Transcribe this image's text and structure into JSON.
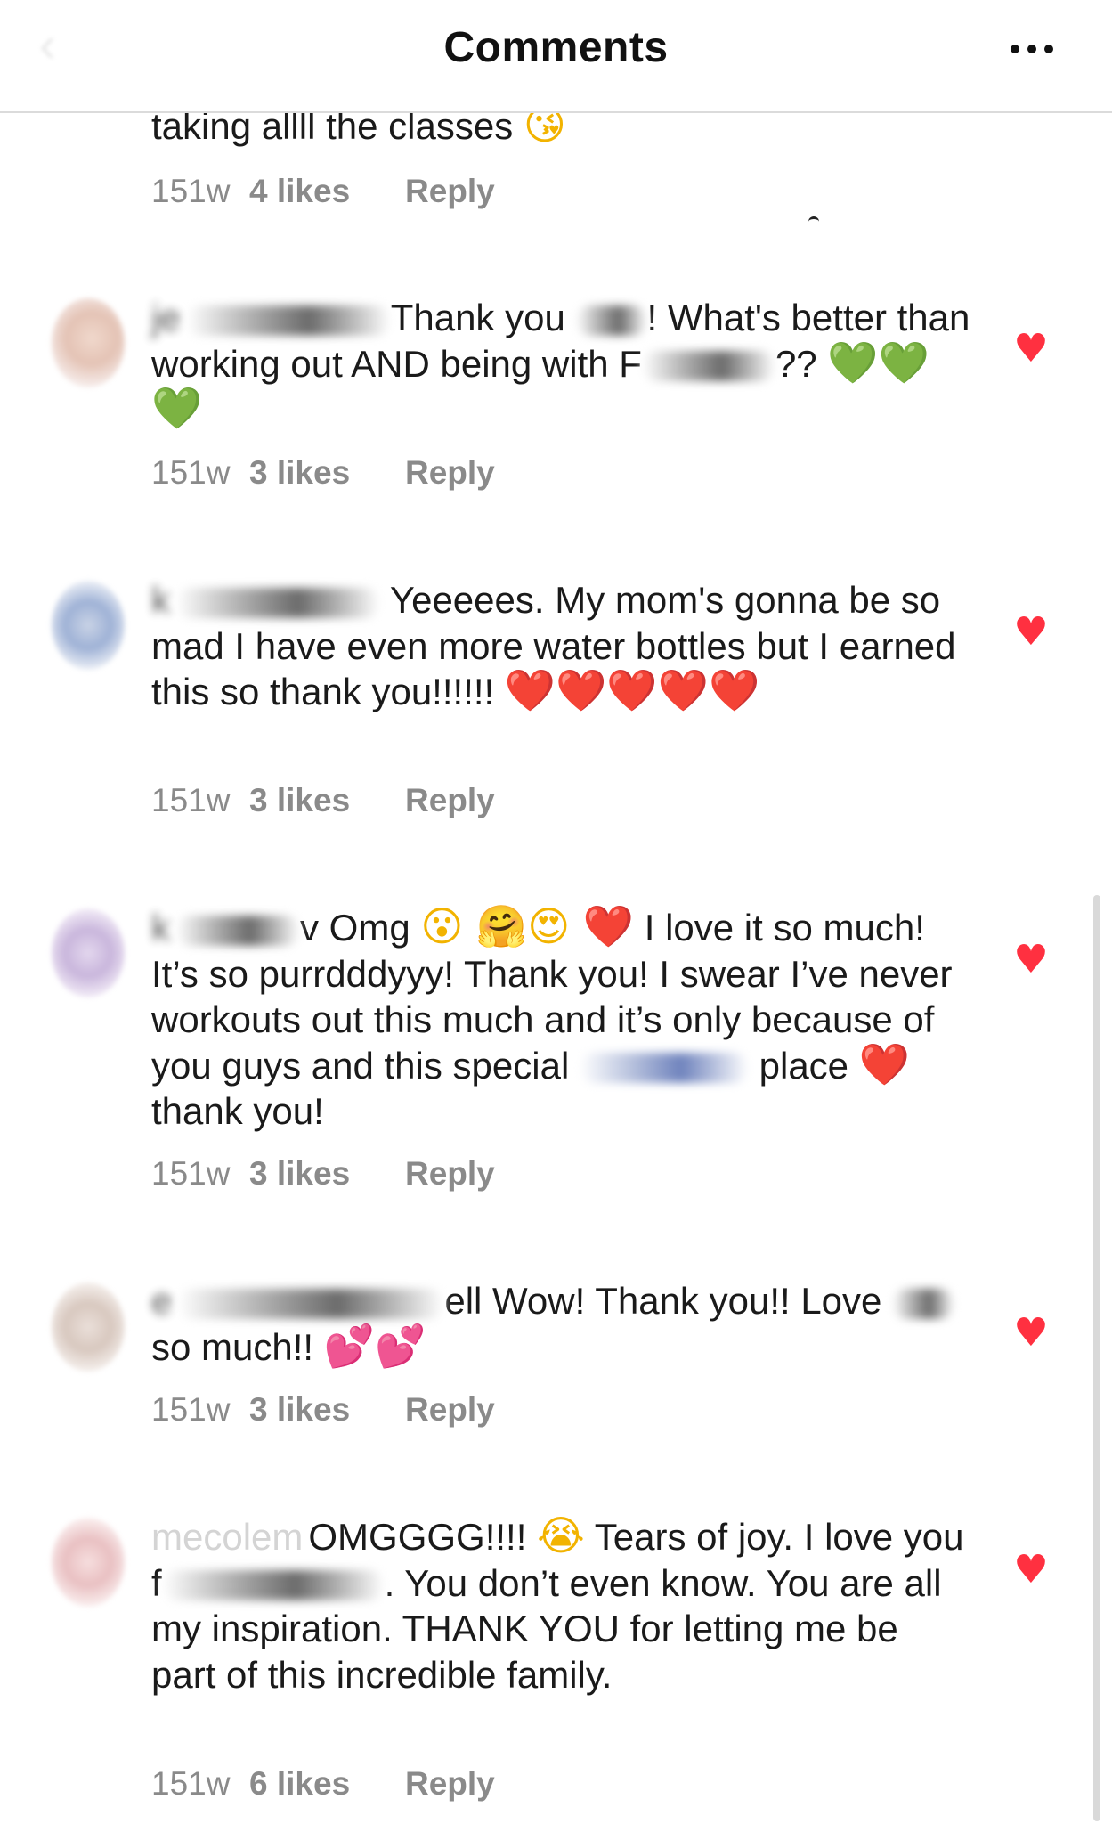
{
  "header": {
    "title": "Comments",
    "back_icon": "chevron-left-icon",
    "more_icon": "more-horizontal-icon"
  },
  "colors": {
    "heart": "#ff3040",
    "meta": "#8a8a8a",
    "divider": "#dbdbdb"
  },
  "first_comment": {
    "text": "taking allll the classes",
    "emoji": "😘",
    "time": "151w",
    "likes": "4 likes",
    "reply": "Reply"
  },
  "comments": [
    {
      "username": "je",
      "text_a": "Thank you",
      "text_b": "! What's better than working out AND being with",
      "text_c": "F",
      "text_d": "??",
      "emoji": "💚💚💚",
      "time": "151w",
      "likes": "3 likes",
      "reply": "Reply",
      "liked": true
    },
    {
      "username": "k",
      "text": "Yeeeees. My mom's gonna be so mad I have even more water bottles but I earned this so thank you!!!!!!",
      "emoji": "❤️❤️❤️❤️❤️",
      "time": "151w",
      "likes": "3 likes",
      "reply": "Reply",
      "liked": true
    },
    {
      "username": "k",
      "text_a": "v Omg",
      "emoji_a": "😮 🤗😍 ❤️",
      "text_b": "I love it so much! It’s so purrdddyyy! Thank you! I swear I’ve never workouts out this much and it’s only because of you guys and this special",
      "text_c": "place",
      "emoji_b": "❤️",
      "text_d": "thank you!",
      "time": "151w",
      "likes": "3 likes",
      "reply": "Reply",
      "liked": true
    },
    {
      "username": "e",
      "text_a": "ell Wow! Thank you!! Love",
      "text_b": "so much!!",
      "emoji": "💕💕",
      "time": "151w",
      "likes": "3 likes",
      "reply": "Reply",
      "liked": true
    },
    {
      "username": "mecolem",
      "text_a": "OMGGGG!!!!",
      "emoji": "😭",
      "text_b": "Tears of joy. I love you f",
      "text_c": ". You don’t even know. You are all my inspiration. THANK YOU for letting me be part of this incredible family.",
      "time": "151w",
      "likes": "6 likes",
      "reply": "Reply",
      "liked": true
    }
  ]
}
